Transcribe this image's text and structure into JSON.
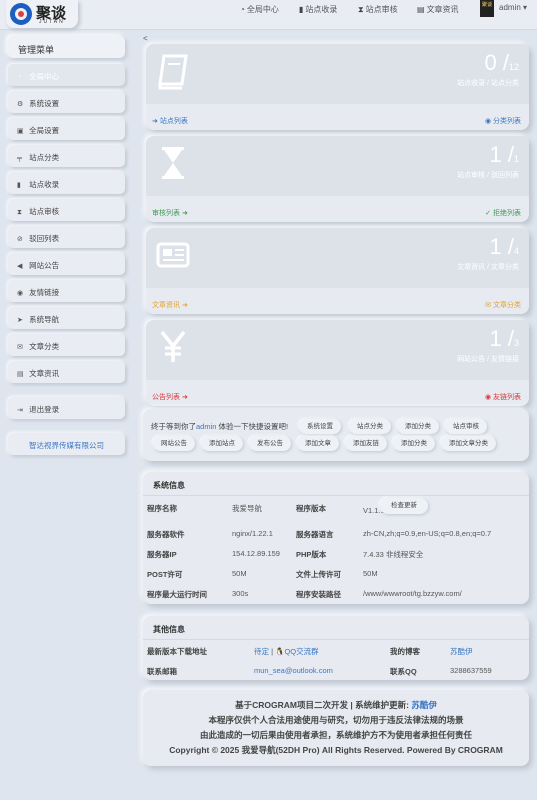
{
  "header": {
    "logo_cn": "聚谈",
    "logo_en": "JUTAN",
    "nav": [
      {
        "label": "全局中心",
        "icon": "gauge-icon"
      },
      {
        "label": "站点收录",
        "icon": "book-icon"
      },
      {
        "label": "站点审核",
        "icon": "hourglass-icon"
      },
      {
        "label": "文章资讯",
        "icon": "newspaper-icon"
      }
    ],
    "avatar_text": "聚谈",
    "user": "admin"
  },
  "sidebar": {
    "title": "管理菜单",
    "items": [
      {
        "label": "全局中心",
        "icon": "gauge-icon",
        "active": true
      },
      {
        "label": "系统设置",
        "icon": "gear-icon"
      },
      {
        "label": "全局设置",
        "icon": "image-icon"
      },
      {
        "label": "站点分类",
        "icon": "sitemap-icon"
      },
      {
        "label": "站点收录",
        "icon": "book-icon"
      },
      {
        "label": "站点审核",
        "icon": "hourglass-icon"
      },
      {
        "label": "驳回列表",
        "icon": "ban-icon"
      },
      {
        "label": "网站公告",
        "icon": "bullhorn-icon"
      },
      {
        "label": "友情链接",
        "icon": "eye-icon"
      },
      {
        "label": "系统导航",
        "icon": "location-arrow-icon"
      },
      {
        "label": "文章分类",
        "icon": "envelope-icon"
      },
      {
        "label": "文章资讯",
        "icon": "newspaper-icon"
      }
    ],
    "logout": "退出登录",
    "company": "智达视界传媒有限公司"
  },
  "back_glyph": "<",
  "stats": [
    {
      "num": "0",
      "total": "12",
      "sub": "站点收录 / 站点分类",
      "icon": "book-icon",
      "left": "站点列表",
      "right": "分类列表",
      "left_color": "#3a76c4",
      "right_color": "#3a76c4"
    },
    {
      "num": "1",
      "total": "1",
      "sub": "站点审核 / 驳回列表",
      "icon": "hourglass-icon",
      "left": "审核列表",
      "right": "拒绝列表",
      "left_color": "#3f9a52",
      "right_color": "#3f9a52"
    },
    {
      "num": "1",
      "total": "4",
      "sub": "文章资讯 / 文章分类",
      "icon": "newspaper-icon",
      "left": "文章资讯",
      "right": "文章分类",
      "left_color": "#e0a030",
      "right_color": "#e0a030"
    },
    {
      "num": "1",
      "total": "3",
      "sub": "网站公告 / 友情链接",
      "icon": "yen-icon",
      "left": "公告列表",
      "right": "友链列表",
      "left_color": "#d9383a",
      "right_color": "#d9383a"
    }
  ],
  "quick": {
    "prefix": "终于等到你了",
    "user": "admin",
    "suffix": "体验一下快捷设置吧!",
    "buttons": [
      "系统设置",
      "站点分类",
      "添加分类",
      "站点审核",
      "网站公告",
      "添加站点",
      "发布公告",
      "添加文章",
      "添加友链",
      "添加分类",
      "添加文章分类"
    ]
  },
  "sysinfo": {
    "title": "系统信息",
    "rows": [
      {
        "l1": "程序名称",
        "v1": "我爱导航",
        "l2": "程序版本",
        "v2": "V1.1.1"
      },
      {
        "l1": "服务器软件",
        "v1": "nginx/1.22.1",
        "l2": "服务器语言",
        "v2": "zh-CN,zh;q=0.9,en-US;q=0.8,en;q=0.7"
      },
      {
        "l1": "服务器IP",
        "v1": "154.12.89.159",
        "l2": "PHP版本",
        "v2": "7.4.33 非线程安全"
      },
      {
        "l1": "POST许可",
        "v1": "50M",
        "l2": "文件上传许可",
        "v2": "50M"
      },
      {
        "l1": "程序最大运行时间",
        "v1": "300s",
        "l2": "程序安装路径",
        "v2": "/www/wwwroot/tg.bzzyw.com/"
      }
    ],
    "check_update": "检查更新"
  },
  "other": {
    "title": "其他信息",
    "download_label": "最新版本下载地址",
    "download_val": "待定",
    "qq_group": "QQ交流群",
    "blog_label": "我的博客",
    "blog_val": "苏酷伊",
    "email_label": "联系邮箱",
    "email_val": "mun_sea@outlook.com",
    "qq_label": "联系QQ",
    "qq_val": "3288637559"
  },
  "footer": {
    "line1_prefix": "基于CROGRAM项目二次开发 | 系统维护更新:",
    "line1_link": "苏酷伊",
    "line2": "本程序仅供个人合法用途使用与研究，切勿用于违反法律法规的场景",
    "line3": "由此造成的一切后果由使用者承担，系统维护方不为使用者承担任何责任",
    "line4": "Copyright © 2025 我爱导航(52DH Pro) All Rights Reserved. Powered By CROGRAM"
  },
  "colors": {
    "accent": "#3a76c4",
    "green": "#3f9a52",
    "orange": "#e0a030",
    "red": "#d9383a",
    "background": "#dfe5ee"
  }
}
